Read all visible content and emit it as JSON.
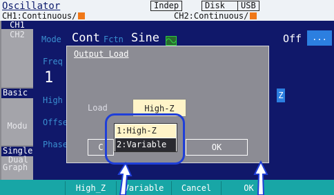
{
  "header": {
    "title": "Oscillator",
    "indep": "Indep",
    "disk": "Disk",
    "usb": "USB",
    "ch1": "CH1:Continuous/",
    "ch2": "CH2:Continuous/"
  },
  "left_menu": {
    "ch1": "CH1",
    "ch2": "CH2",
    "basic": "Basic",
    "modu": "Modu",
    "single": "Single",
    "dual": "Dual",
    "graph": "Graph"
  },
  "main": {
    "mode_label": "Mode",
    "mode_value": "Cont",
    "fctn_label": "Fctn",
    "fctn_value": "Sine",
    "freq_label": "Freq",
    "freq_value": "1",
    "high_label": "High",
    "offset_label": "Offse",
    "phase_label": "Phase",
    "output_state": "Off",
    "off_button": "...",
    "z_indicator": "Z"
  },
  "dialog": {
    "title": "Output Load",
    "load_label": "Load",
    "load_value": "High-Z",
    "cancel_label": "C",
    "ok_label": "OK"
  },
  "dropdown": {
    "options": [
      "1:High-Z",
      "2:Variable"
    ],
    "selected": "2:Variable"
  },
  "softkeys": {
    "high_z": "High_Z",
    "variable": "Variable",
    "cancel": "Cancel",
    "ok": "OK"
  },
  "colors": {
    "screen_bg": "#10186a",
    "dialog_bg": "#8c8c94",
    "softkey_bar": "#18a6a6",
    "highlight": "#1f3fd8",
    "indicator_orange": "#f07818"
  }
}
